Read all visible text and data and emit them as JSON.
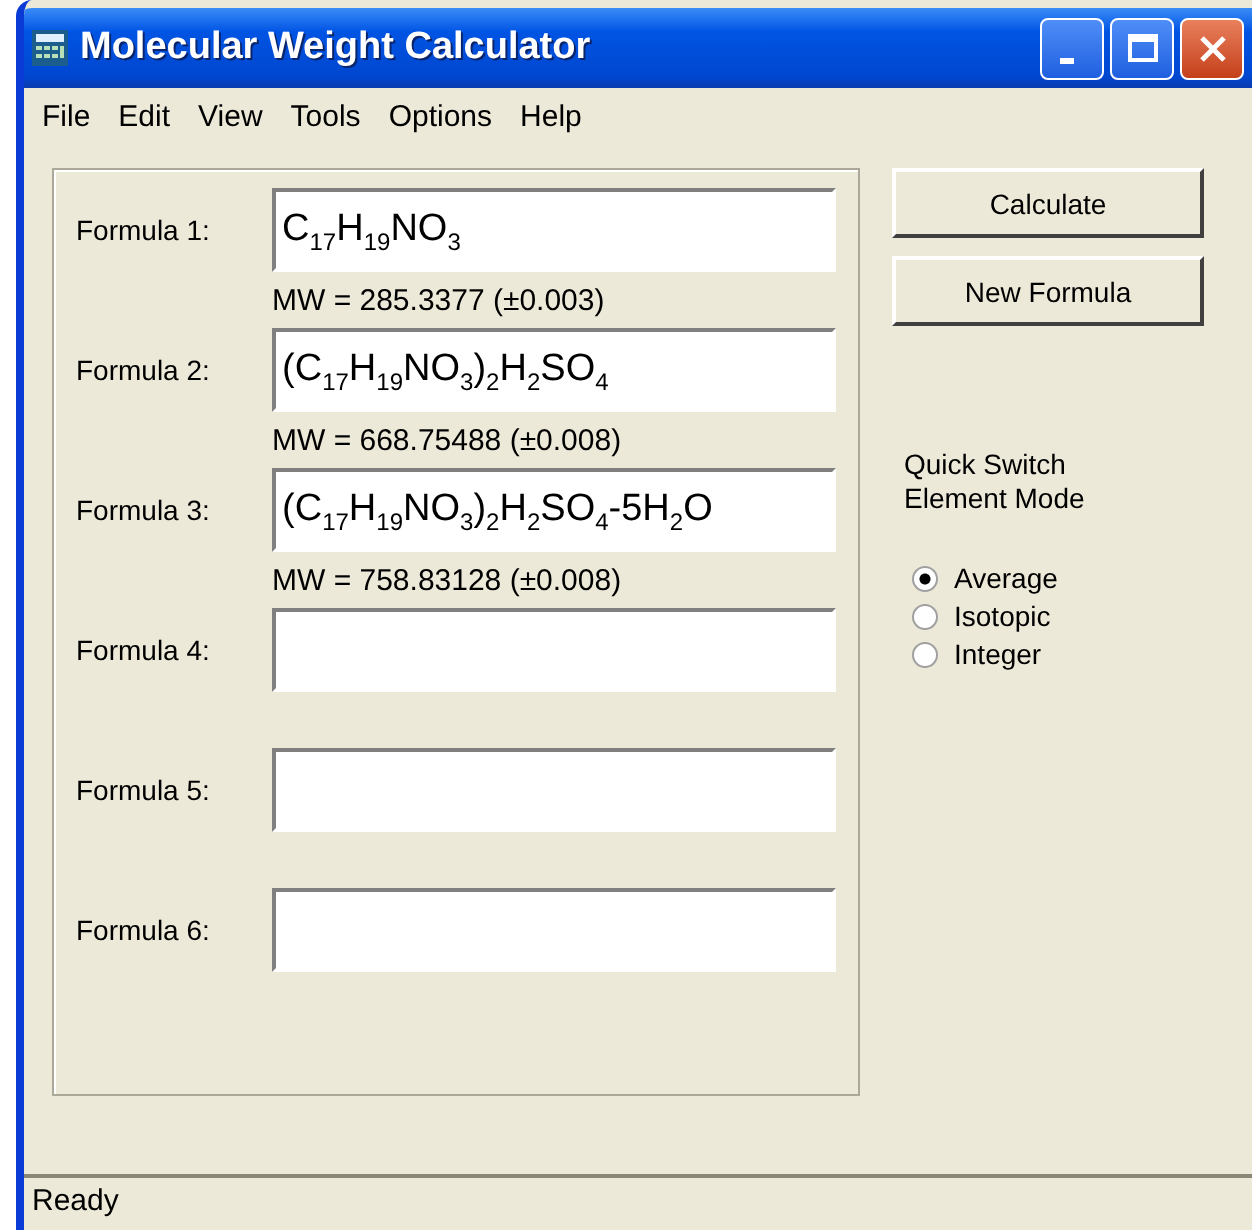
{
  "window": {
    "title": "Molecular Weight Calculator"
  },
  "menu": [
    "File",
    "Edit",
    "View",
    "Tools",
    "Options",
    "Help"
  ],
  "formulas": [
    {
      "label": "Formula 1:",
      "value": "C$_{17}$H$_{19}$NO$_{3}$",
      "result": "MW = 285.3377 (±0.003)"
    },
    {
      "label": "Formula 2:",
      "value": "(C$_{17}$H$_{19}$NO$_{3}$)$_{2}$H$_{2}$SO$_{4}$",
      "result": "MW = 668.75488 (±0.008)"
    },
    {
      "label": "Formula 3:",
      "value": "(C$_{17}$H$_{19}$NO$_{3}$)$_{2}$H$_{2}$SO$_{4}$-5H$_{2}$O",
      "result": "MW = 758.83128 (±0.008)"
    },
    {
      "label": "Formula 4:"
    },
    {
      "label": "Formula 5:"
    },
    {
      "label": "Formula 6:"
    }
  ],
  "buttons": [
    "Calculate",
    "New Formula"
  ],
  "mode_label": "Quick Switch Element Mode",
  "modes": [
    {
      "label": "Average",
      "selected": true
    },
    {
      "label": "Isotopic",
      "selected": false
    },
    {
      "label": "Integer",
      "selected": false
    }
  ],
  "status_bar": "Ready"
}
